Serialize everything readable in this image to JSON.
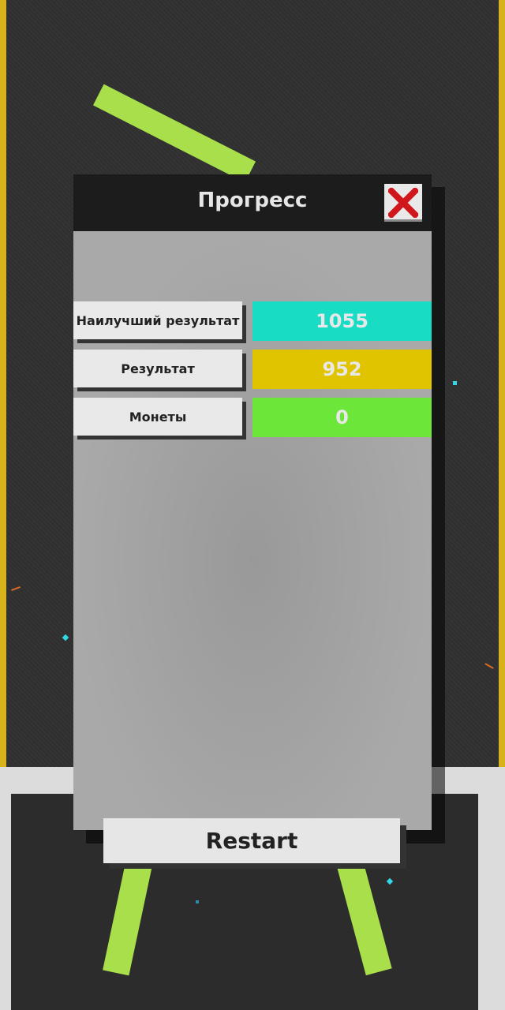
{
  "dialog": {
    "title": "Прогресс",
    "close_icon": "close-x-icon",
    "close_icon_color": "#d0171b"
  },
  "stats": [
    {
      "label": "Наилучший результат",
      "value": "1055",
      "color": "#19dcc4"
    },
    {
      "label": "Результат",
      "value": "952",
      "color": "#e1c400"
    },
    {
      "label": "Монеты",
      "value": "0",
      "color": "#6de63a"
    }
  ],
  "restart": {
    "label": "Restart"
  },
  "colors": {
    "background": "#2f2f2f",
    "rail": "#d8b21a",
    "stick": "#a8df4a"
  }
}
